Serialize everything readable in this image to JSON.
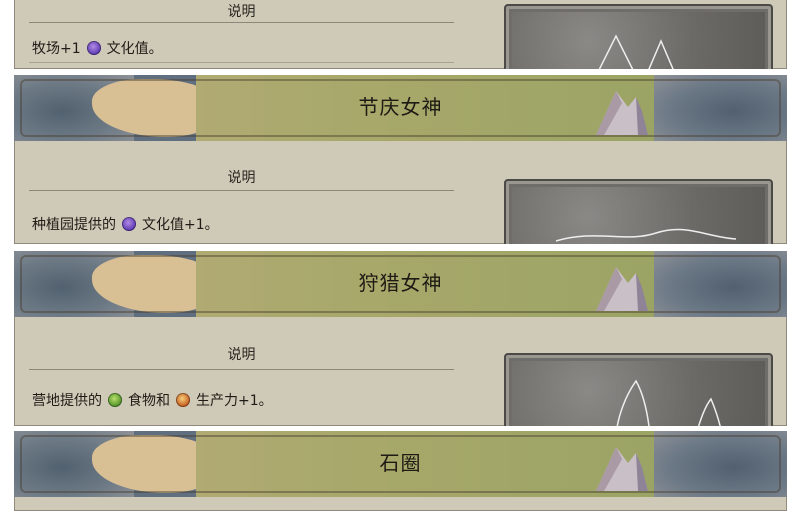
{
  "cards": [
    {
      "title": "",
      "section": "说明",
      "desc_before": "牧场+1",
      "icons": [
        "culture-icon"
      ],
      "desc_mid": "",
      "desc_after": "文化值。"
    },
    {
      "title": "节庆女神",
      "section": "说明",
      "desc_before": "种植园提供的",
      "icons": [
        "culture-icon"
      ],
      "desc_mid": "",
      "desc_after": "文化值+1。"
    },
    {
      "title": "狩猎女神",
      "section": "说明",
      "desc_before": "营地提供的",
      "icons": [
        "food-icon",
        "production-icon"
      ],
      "desc_mid": "食物和",
      "desc_after": "生产力+1。"
    },
    {
      "title": "石圈",
      "section": "",
      "desc_before": "",
      "icons": [],
      "desc_mid": "",
      "desc_after": ""
    }
  ],
  "colors": {
    "card_bg": "#cfc9b8",
    "sea": "#5f6f80",
    "grass": "#a7a86a",
    "sand": "#d8bf94",
    "culture": "#5a36b0",
    "food": "#4c8e27",
    "production": "#c2561c"
  }
}
